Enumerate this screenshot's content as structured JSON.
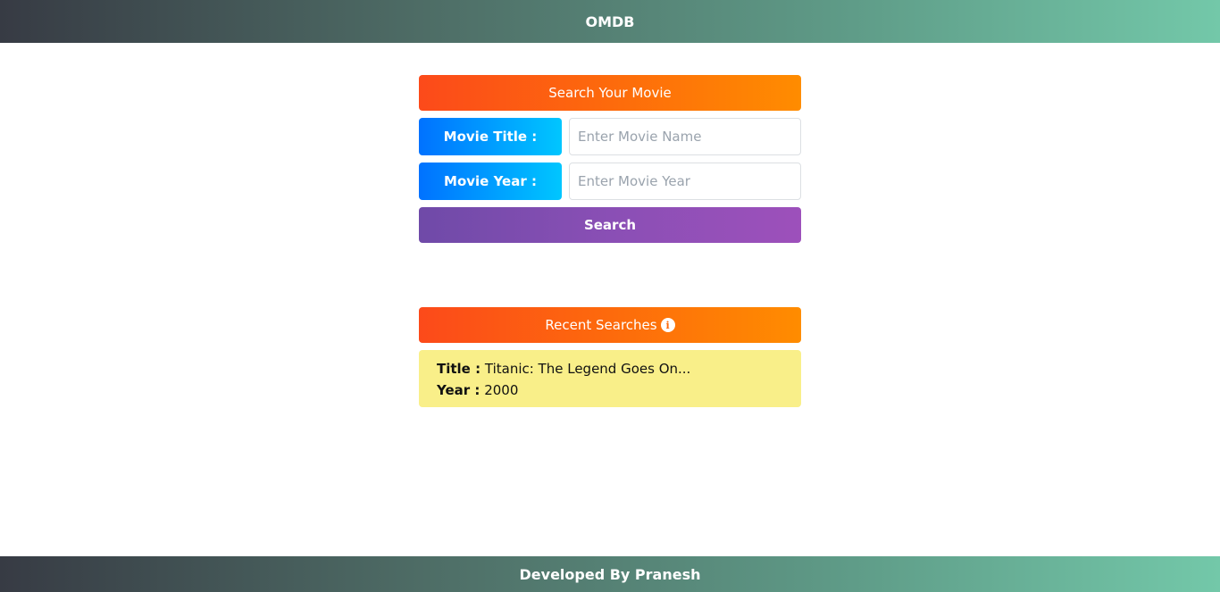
{
  "header": {
    "title": "OMDB"
  },
  "search_form": {
    "heading": "Search Your Movie",
    "title_label": "Movie Title :",
    "title_placeholder": "Enter Movie Name",
    "title_value": "",
    "year_label": "Movie Year :",
    "year_placeholder": "Enter Movie Year",
    "year_value": "",
    "search_button": "Search"
  },
  "recent": {
    "heading": "Recent Searches",
    "info_icon": "info-circle-icon",
    "items": [
      {
        "title_label": "Title :",
        "title": "Titanic: The Legend Goes On...",
        "year_label": "Year :",
        "year": "2000"
      }
    ]
  },
  "footer": {
    "text": "Developed By Pranesh"
  },
  "colors": {
    "header_gradient": [
      "#373b44",
      "#73c8a9"
    ],
    "banner_gradient": [
      "#fc4a1a",
      "#ff8c00"
    ],
    "label_gradient": [
      "#0072ff",
      "#00c6ff"
    ],
    "search_gradient": [
      "#6f4aa8",
      "#9d50bb"
    ],
    "result_card": "#f9ef89"
  }
}
